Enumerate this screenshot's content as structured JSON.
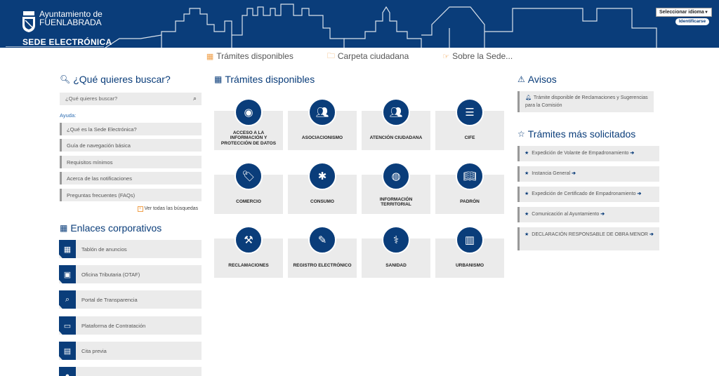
{
  "header": {
    "logo_line1": "Ayuntamiento de",
    "logo_line2": "FUENLABRADA",
    "sede_label": "SEDE ELECTRÓNICA",
    "lang_select_value": "Seleccionar idioma",
    "ident_button": "Identificarse"
  },
  "topnav": {
    "items": [
      {
        "label": "Trámites disponibles",
        "icon": "grid-icon"
      },
      {
        "label": "Carpeta ciudadana",
        "icon": "folder-icon"
      },
      {
        "label": "Sobre la Sede...",
        "icon": "hand-point-icon"
      }
    ]
  },
  "search": {
    "title": "¿Qué quieres buscar?",
    "placeholder": "¿Qué quieres buscar?",
    "ayuda_label": "Ayuda:",
    "help_items": [
      "¿Qué es la Sede Electrónica?",
      "Guía de navegación básica",
      "Requisitos mínimos",
      "Acerca de las notificaciones",
      "Preguntas frecuentes (FAQs)"
    ],
    "ver_todas": "Ver todas las búsquedas"
  },
  "enlaces": {
    "title": "Enlaces corporativos",
    "items": [
      {
        "label": "Tablón de anuncios",
        "icon": "table-icon"
      },
      {
        "label": "Oficina Tributaria (OTAF)",
        "icon": "briefcase-icon"
      },
      {
        "label": "Portal de Transparencia",
        "icon": "search-icon"
      },
      {
        "label": "Plataforma de Contratación",
        "icon": "folder-open-icon"
      },
      {
        "label": "Cita previa",
        "icon": "calendar-icon"
      }
    ]
  },
  "tramites": {
    "title": "Trámites disponibles",
    "tiles": [
      {
        "label": "ACCESO A LA INFORMACIÓN Y PROTECCIÓN DE DATOS",
        "icon": "eye-icon"
      },
      {
        "label": "ASOCIACIONISMO",
        "icon": "users-icon"
      },
      {
        "label": "ATENCIÓN CIUDADANA",
        "icon": "group-icon"
      },
      {
        "label": "CIFE",
        "icon": "list-icon"
      },
      {
        "label": "COMERCIO",
        "icon": "tags-icon"
      },
      {
        "label": "CONSUMO",
        "icon": "asterisk-icon"
      },
      {
        "label": "INFORMACIÓN TERRITORIAL",
        "icon": "globe-icon"
      },
      {
        "label": "PADRÓN",
        "icon": "book-icon"
      },
      {
        "label": "RECLAMACIONES",
        "icon": "gavel-icon"
      },
      {
        "label": "REGISTRO ELECTRÓNICO",
        "icon": "edit-icon"
      },
      {
        "label": "SANIDAD",
        "icon": "doctor-icon"
      },
      {
        "label": "URBANISMO",
        "icon": "building-icon"
      }
    ]
  },
  "avisos": {
    "title": "Avisos",
    "items": [
      "Trámite disponible de Reclamaciones y Sugerencias para la Comisión"
    ]
  },
  "mas_solicitados": {
    "title": "Trámites más solicitados",
    "items": [
      "Expedición de Volante de Empadronamiento",
      "Instancia General",
      "Expedición de Certificado de Empadronamiento",
      "Comunicación al Ayuntamiento",
      "DECLARACIÓN RESPONSABLE DE OBRA MENOR"
    ]
  },
  "colors": {
    "brand": "#0a3d7a",
    "accent": "#f0a04b",
    "tile_bg": "#ebebeb"
  }
}
